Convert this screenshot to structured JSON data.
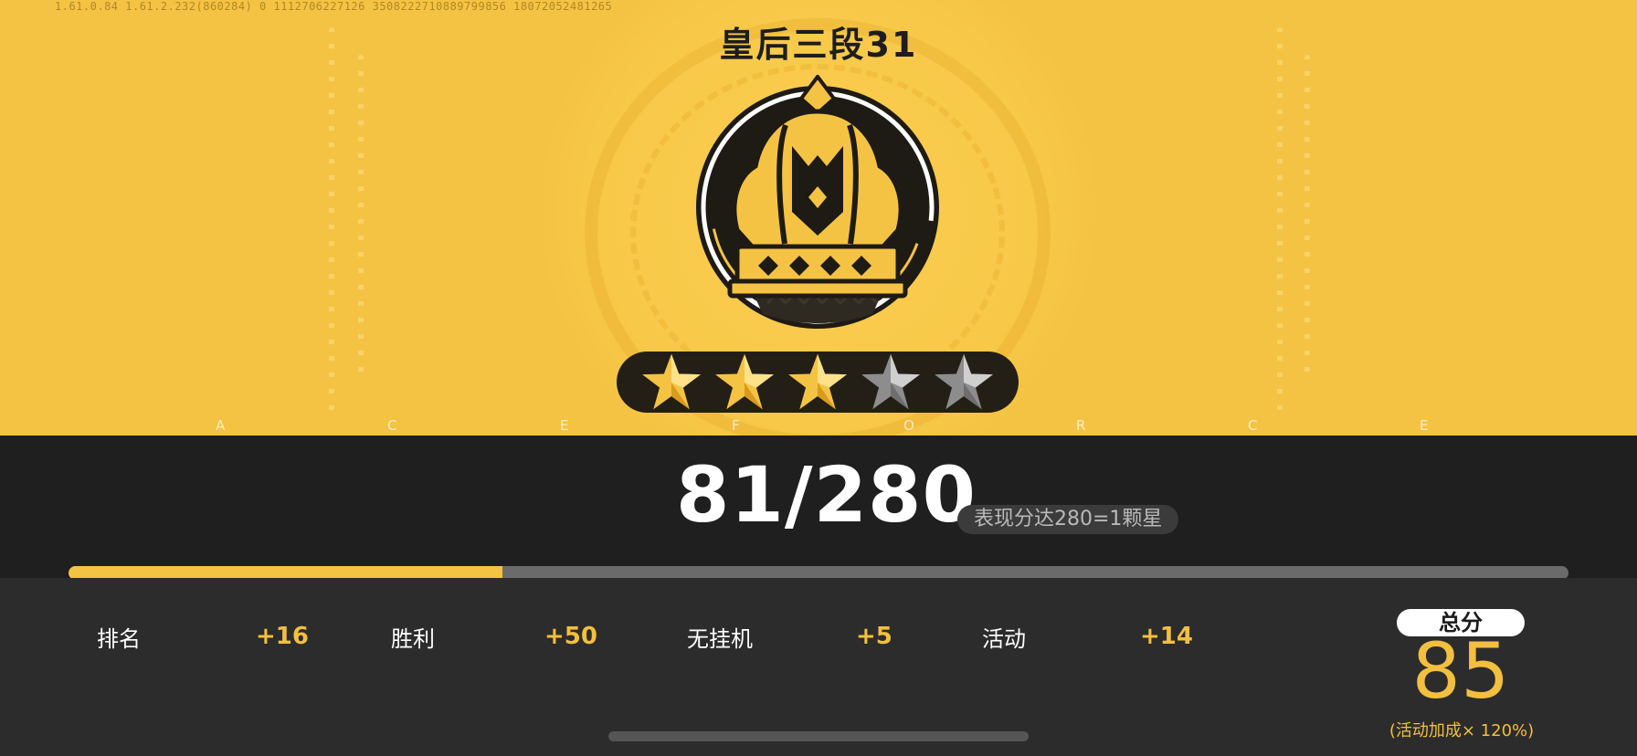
{
  "header": {
    "version_text": "1.61.0.84  1.61.2.232(860284)  0  1112706227126  3508222710889799856  18072052481265",
    "rank_title": "皇后三段31"
  },
  "rank": {
    "stars_filled": 3,
    "stars_total": 5,
    "colors": {
      "gold": "#f5c343",
      "dark": "#231f17",
      "grey_star": "#9a9a9a"
    }
  },
  "letters": [
    "A",
    "C",
    "E",
    "F",
    "O",
    "R",
    "C",
    "E"
  ],
  "performance": {
    "score_text": "81/280",
    "progress_fraction": 0.289,
    "hint": "表现分达280=1颗星"
  },
  "stats": [
    {
      "label": "排名",
      "value": "+16"
    },
    {
      "label": "胜利",
      "value": "+50"
    },
    {
      "label": "无挂机",
      "value": "+5"
    },
    {
      "label": "活动",
      "value": "+14"
    }
  ],
  "total": {
    "label": "总分",
    "value": "85",
    "bonus": "(活动加成× 120%)"
  }
}
